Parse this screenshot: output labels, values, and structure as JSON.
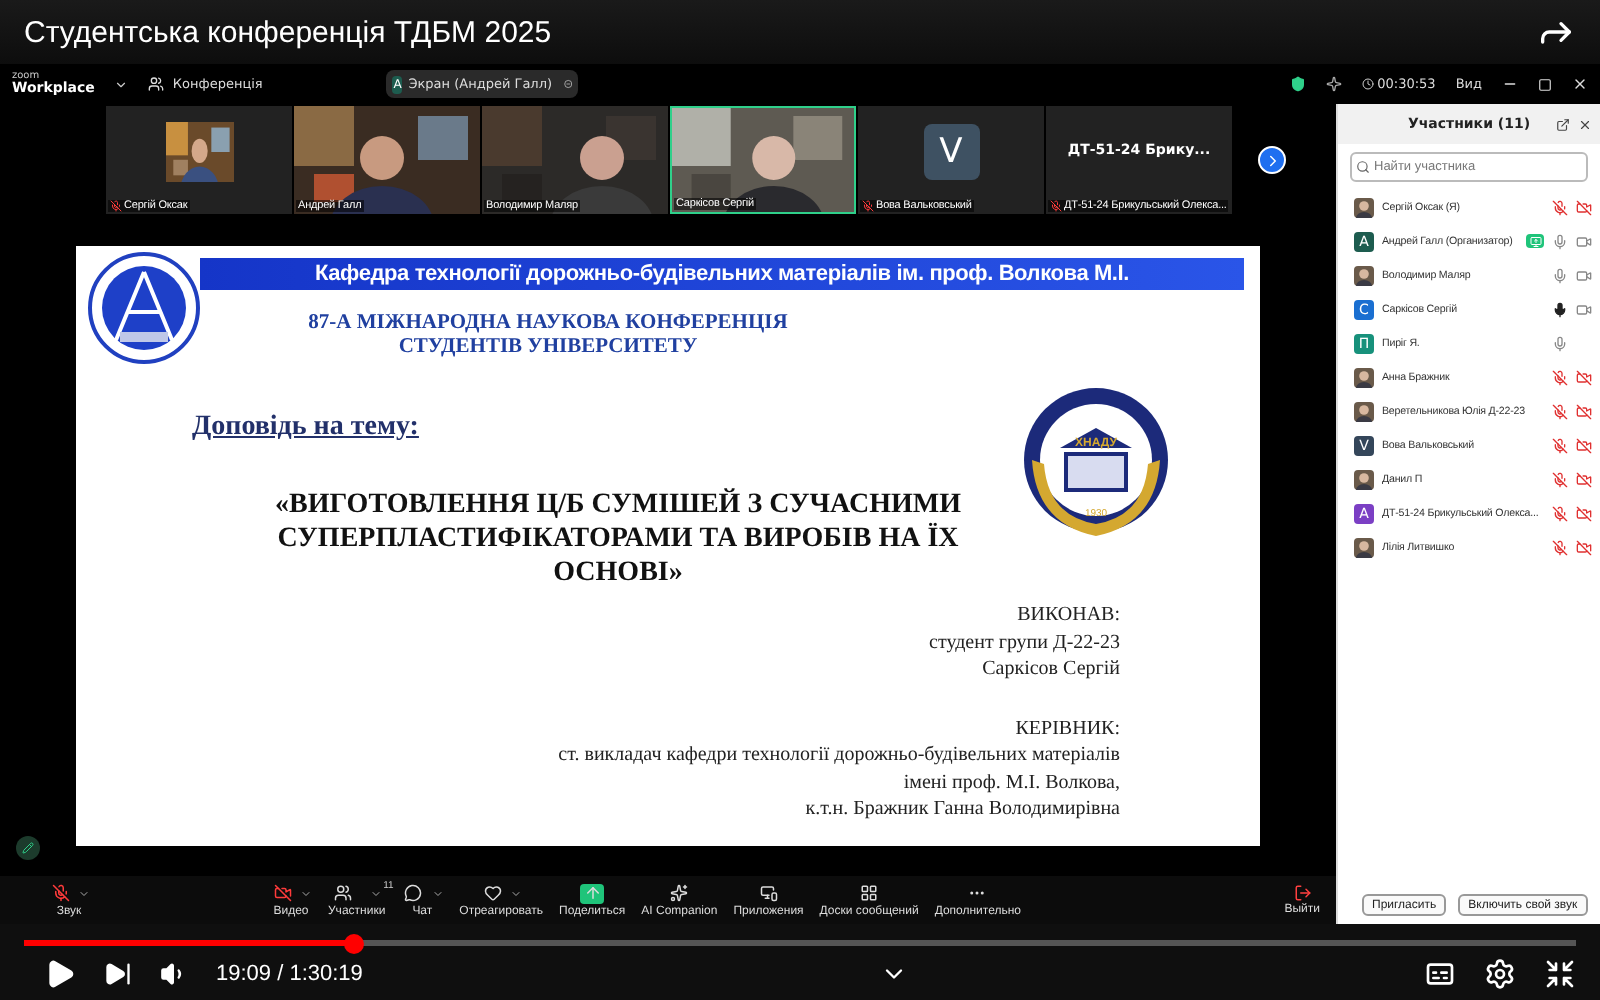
{
  "player": {
    "title": "Студентська конференція ТДБМ 2025",
    "progress": {
      "level": 0.212
    },
    "time": "19:09 / 1:30:19"
  },
  "zoom_bar": {
    "logo_small": "zoom",
    "logo": "Workplace",
    "meeting": "Конференція",
    "screen_badge": {
      "letter": "A",
      "label": "Экран (Андрей Галл)"
    },
    "timer": "00:30:53",
    "view": "Вид"
  },
  "tiles": [
    {
      "name": "Сергій Оксак",
      "kind": "inset",
      "muted": true,
      "selected": false
    },
    {
      "name": "Андрей Галл",
      "kind": "video",
      "muted": false,
      "selected": false
    },
    {
      "name": "Володимир Маляр",
      "kind": "video",
      "muted": false,
      "selected": false
    },
    {
      "name": "Саркісов Сергій",
      "kind": "video",
      "muted": false,
      "selected": true
    },
    {
      "name": "Вова Вальковський",
      "kind": "letter",
      "letter": "V",
      "muted": true,
      "selected": false
    },
    {
      "name": "ДТ-51-24 Брикульський Олекса...",
      "kind": "title",
      "title": "ДТ-51-24 Брику...",
      "muted": true,
      "selected": false
    }
  ],
  "slide": {
    "header": "Кафедра технології дорожньо-будівельних матеріалів ім. проф. Волкова М.І.",
    "conference": [
      "87-А МІЖНАРОДНА НАУКОВА КОНФЕРЕНЦІЯ",
      "СТУДЕНТІВ УНІВЕРСИТЕТУ"
    ],
    "emblem": {
      "name": "ХНАДУ",
      "year": "1930"
    },
    "subject_label": "Доповідь на тему:",
    "title": "«ВИГОТОВЛЕННЯ Ц/Б СУМІШЕЙ З СУЧАСНИМИ СУПЕРПЛАСТИФІКАТОРАМИ ТА ВИРОБІВ НА ЇХ ОСНОВІ»",
    "author": [
      "ВИКОНАВ:",
      "студент групи Д-22-23",
      "Саркісов Сергій"
    ],
    "supervisor": [
      "КЕРІВНИК:",
      "ст. викладач кафедри технології дорожньо-будівельних матеріалів",
      "імені проф. М.І. Волкова,",
      "к.т.н. Бражник Ганна Володимирівна"
    ]
  },
  "toolbar": [
    {
      "label": "Звук",
      "off": true,
      "accent": false,
      "menu": true
    },
    {
      "label": "Видео",
      "off": true,
      "accent": false,
      "menu": true
    },
    {
      "label": "Участники",
      "count": "11",
      "off": false,
      "accent": false,
      "menu": true
    },
    {
      "label": "Чат",
      "off": false,
      "accent": false,
      "menu": true
    },
    {
      "label": "Отреагировать",
      "off": false,
      "accent": false,
      "menu": true
    },
    {
      "label": "Поделиться",
      "off": false,
      "accent": true,
      "menu": false
    },
    {
      "label": "AI Companion",
      "off": false,
      "accent": false,
      "menu": false
    },
    {
      "label": "Приложения",
      "off": false,
      "accent": false,
      "menu": false
    },
    {
      "label": "Доски сообщений",
      "off": false,
      "accent": false,
      "menu": false
    },
    {
      "label": "Дополнительно",
      "off": false,
      "accent": false,
      "menu": false
    }
  ],
  "leave": "Выйти",
  "panel": {
    "title": "Участники (11)",
    "search": {
      "placeholder": "Найти участника"
    },
    "participants": [
      {
        "name": "Сергій Оксак (Я)",
        "sharing": false,
        "muted": true,
        "speaking": false,
        "camera": true,
        "video_blocked": true
      },
      {
        "name": "Андрей Галл (Организатор)",
        "avatar": {
          "kind": "letter",
          "letter": "A",
          "color": "#1d5c4f"
        },
        "sharing": true,
        "muted": false,
        "speaking": false,
        "camera": true,
        "video_blocked": false
      },
      {
        "name": "Володимир Маляр",
        "sharing": false,
        "muted": false,
        "speaking": false,
        "camera": true,
        "video_blocked": false
      },
      {
        "name": "Саркісов Сергій",
        "avatar": {
          "kind": "letter",
          "letter": "C",
          "color": "#1a6fd1"
        },
        "sharing": false,
        "muted": false,
        "speaking": true,
        "camera": true,
        "video_blocked": false
      },
      {
        "name": "Пиріг Я.",
        "avatar": {
          "kind": "letter",
          "letter": "П",
          "color": "#17917b"
        },
        "sharing": false,
        "muted": false,
        "speaking": false,
        "camera": false
      },
      {
        "name": "Анна Бражник",
        "sharing": false,
        "muted": true,
        "speaking": false,
        "camera": true,
        "video_blocked": true
      },
      {
        "name": "Веретельникова Юлія Д-22-23",
        "sharing": false,
        "muted": true,
        "speaking": false,
        "camera": true,
        "video_blocked": true
      },
      {
        "name": "Вова Вальковський",
        "avatar": {
          "kind": "letter",
          "letter": "V",
          "color": "#34465a"
        },
        "sharing": false,
        "muted": true,
        "speaking": false,
        "camera": true,
        "video_blocked": true
      },
      {
        "name": "Данил П",
        "sharing": false,
        "muted": true,
        "speaking": false,
        "camera": true,
        "video_blocked": true
      },
      {
        "name": "ДТ-51-24 Брикульський Олекса...",
        "avatar": {
          "kind": "letter",
          "letter": "A",
          "color": "#7b3fc4"
        },
        "sharing": false,
        "muted": true,
        "speaking": false,
        "camera": true,
        "video_blocked": true
      },
      {
        "name": "Лілія Литвишко",
        "sharing": false,
        "muted": true,
        "speaking": false,
        "camera": true,
        "video_blocked": true
      }
    ],
    "buttons": [
      "Пригласить",
      "Включить свой звук"
    ]
  }
}
